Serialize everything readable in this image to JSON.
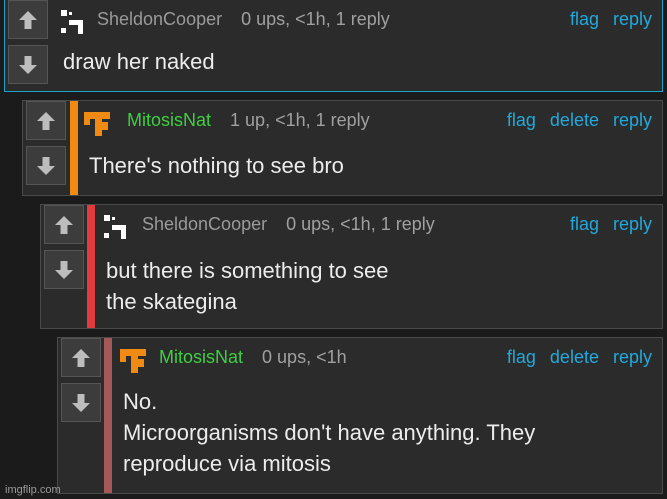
{
  "comments": [
    {
      "username": "SheldonCooper",
      "meta": "0 ups, <1h, 1 reply",
      "actions": {
        "flag": "flag",
        "reply": "reply"
      },
      "text": [
        "draw her naked"
      ],
      "avatar_icon": "qr-pattern-avatar-icon"
    },
    {
      "username": "MitosisNat",
      "meta": "1 up, <1h, 1 reply",
      "actions": {
        "flag": "flag",
        "delete": "delete",
        "reply": "reply"
      },
      "text": [
        "There's nothing to see bro"
      ],
      "avatar_icon": "orange-block-avatar-icon",
      "stripe_color": "#f08a12"
    },
    {
      "username": "SheldonCooper",
      "meta": "0 ups, <1h, 1 reply",
      "actions": {
        "flag": "flag",
        "reply": "reply"
      },
      "text": [
        "but there is something to see",
        "the skategina"
      ],
      "avatar_icon": "qr-pattern-avatar-icon",
      "stripe_color": "#e23b3b"
    },
    {
      "username": "MitosisNat",
      "meta": "0 ups, <1h",
      "actions": {
        "flag": "flag",
        "delete": "delete",
        "reply": "reply"
      },
      "text": [
        "No.",
        "Microorganisms don't have anything. They",
        "reproduce via mitosis"
      ],
      "avatar_icon": "orange-block-avatar-icon",
      "stripe_color": "#a65757"
    }
  ],
  "colors": {
    "background": "#1b1b1b",
    "panel": "#2b2b2b",
    "link": "#22a9dc",
    "username_green": "#3ecf42",
    "highlight_border": "#1ba3c9"
  },
  "watermark": "imgflip.com"
}
